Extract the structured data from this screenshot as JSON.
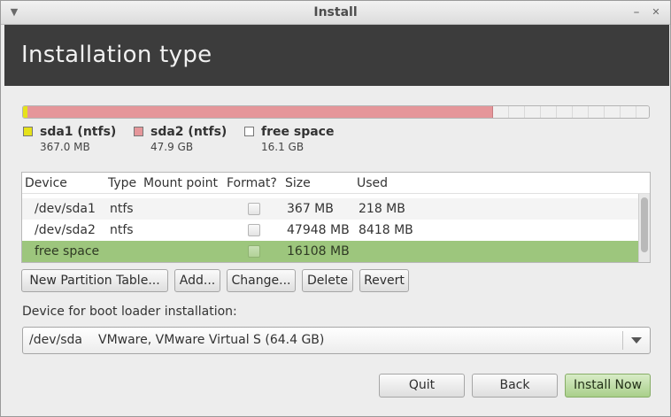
{
  "window": {
    "title": "Install"
  },
  "header": {
    "title": "Installation type"
  },
  "partition_bar": {
    "segments": [
      {
        "name": "sda1 (ntfs)",
        "size": "367.0 MB",
        "color": "#e6e21a",
        "size_mb": 367.0
      },
      {
        "name": "sda2 (ntfs)",
        "size": "47.9 GB",
        "color": "#e5969a",
        "size_mb": 47948
      },
      {
        "name": "free space",
        "size": "16.1 GB",
        "color": "#f0f0f0",
        "size_mb": 16108
      }
    ]
  },
  "table": {
    "columns": [
      "Device",
      "Type",
      "Mount point",
      "Format?",
      "Size",
      "Used"
    ],
    "rows": [
      {
        "device": "/dev/sda1",
        "type": "ntfs",
        "mount": "",
        "format": false,
        "size": "367 MB",
        "used": "218 MB"
      },
      {
        "device": "/dev/sda2",
        "type": "ntfs",
        "mount": "",
        "format": false,
        "size": "47948 MB",
        "used": "8418 MB"
      },
      {
        "device": "free space",
        "type": "",
        "mount": "",
        "format": false,
        "size": "16108 MB",
        "used": "",
        "selected": true
      }
    ]
  },
  "partition_buttons": {
    "new_table": "New Partition Table...",
    "add": "Add...",
    "change": "Change...",
    "delete": "Delete",
    "revert": "Revert"
  },
  "bootloader": {
    "label": "Device for boot loader installation:",
    "device": "/dev/sda",
    "description": "VMware, VMware Virtual S (64.4 GB)"
  },
  "footer": {
    "quit": "Quit",
    "back": "Back",
    "install": "Install Now"
  },
  "colors": {
    "header_bg": "#3c3c3c",
    "selected_row": "#9dc67d",
    "install_button": "#a9cf8a"
  }
}
